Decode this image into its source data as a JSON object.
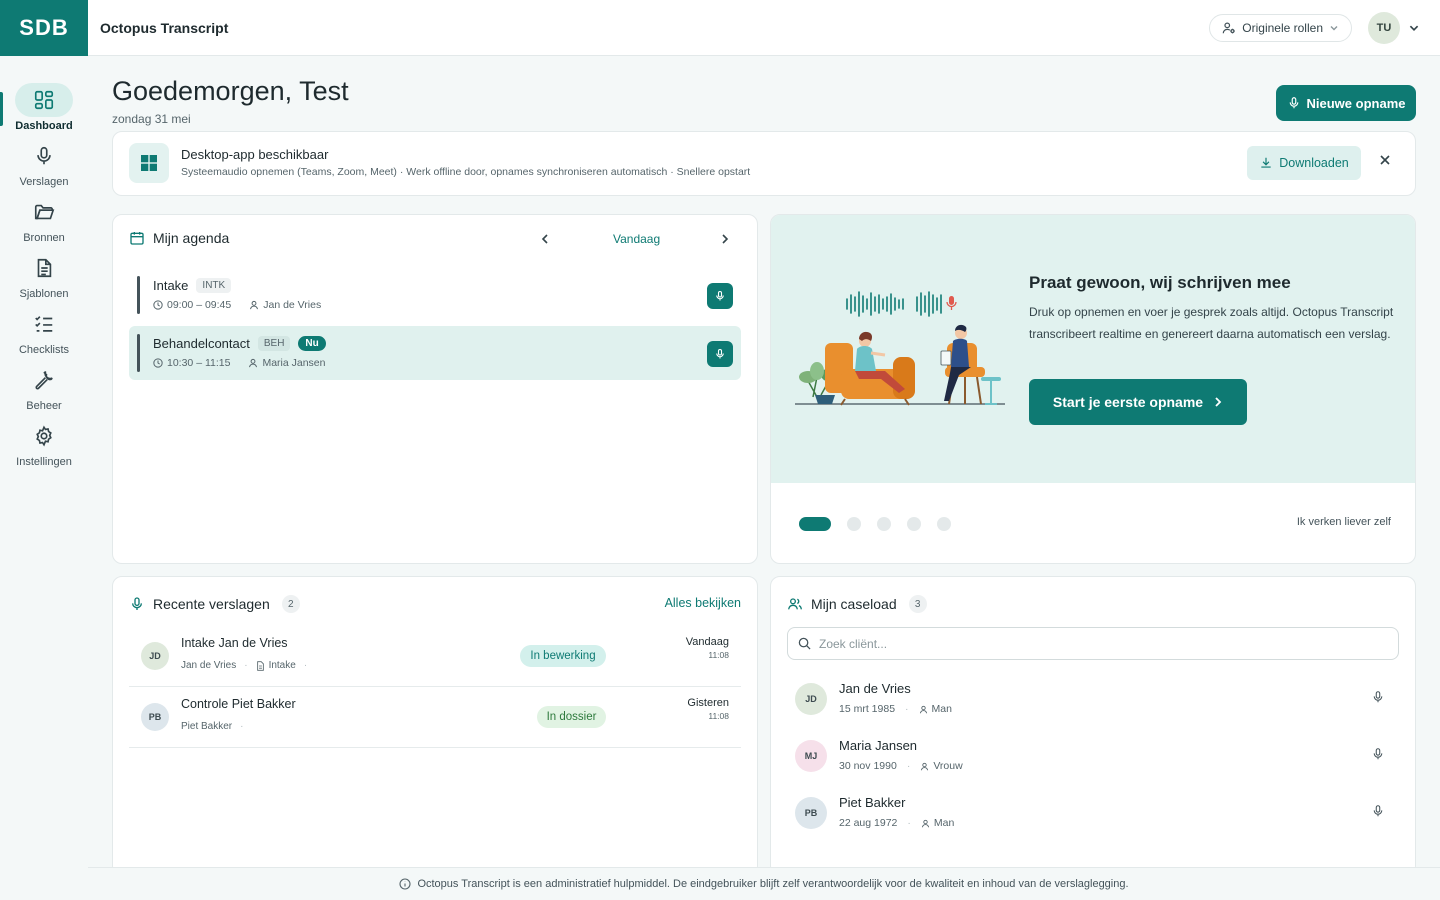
{
  "header": {
    "logo_text": "SDB",
    "app_title": "Octopus Transcript",
    "role_label": "Originele rollen",
    "user_initials": "TU"
  },
  "sidebar": {
    "items": [
      {
        "label": "Dashboard",
        "icon": "dashboard-icon",
        "active": true
      },
      {
        "label": "Verslagen",
        "icon": "mic-icon"
      },
      {
        "label": "Bronnen",
        "icon": "folder-icon"
      },
      {
        "label": "Sjablonen",
        "icon": "document-icon"
      },
      {
        "label": "Checklists",
        "icon": "checklist-icon"
      },
      {
        "label": "Beheer",
        "icon": "wrench-icon"
      },
      {
        "label": "Instellingen",
        "icon": "gear-icon"
      }
    ]
  },
  "page": {
    "greeting": "Goedemorgen, Test",
    "date": "zondag 31 mei",
    "new_recording_label": "Nieuwe opname"
  },
  "banner": {
    "title": "Desktop-app beschikbaar",
    "subtitle": "Systeemaudio opnemen (Teams, Zoom, Meet) · Werk offline door, opnames synchroniseren automatisch · Snellere opstart",
    "download_label": "Downloaden"
  },
  "agenda": {
    "title": "Mijn agenda",
    "today_label": "Vandaag",
    "events": [
      {
        "title": "Intake",
        "tag": "INTK",
        "time": "09:00 – 09:45",
        "client": "Jan de Vries",
        "now": false
      },
      {
        "title": "Behandelcontact",
        "tag": "BEH",
        "now_label": "Nu",
        "time": "10:30 – 11:15",
        "client": "Maria Jansen",
        "now": true
      }
    ]
  },
  "promo": {
    "title": "Praat gewoon, wij schrijven mee",
    "text": "Druk op opnemen en voer je gesprek zoals altijd. Octopus Transcript transcribeert realtime en genereert daarna automatisch een verslag.",
    "button_label": "Start je eerste opname",
    "skip_label": "Ik verken liever zelf",
    "slide_count": 5,
    "active_slide": 1
  },
  "reports": {
    "title": "Recente verslagen",
    "count": "2",
    "see_all_label": "Alles bekijken",
    "items": [
      {
        "initials": "JD",
        "title": "Intake Jan de Vries",
        "client": "Jan de Vries",
        "template": "Intake",
        "status": "In bewerking",
        "when": "Vandaag",
        "time": "11:08"
      },
      {
        "initials": "PB",
        "title": "Controle Piet Bakker",
        "client": "Piet Bakker",
        "template": "",
        "status": "In dossier",
        "when": "Gisteren",
        "time": "11:08"
      }
    ]
  },
  "caseload": {
    "title": "Mijn caseload",
    "count": "3",
    "search_placeholder": "Zoek cliënt...",
    "clients": [
      {
        "initials": "JD",
        "name": "Jan de Vries",
        "dob": "15 mrt 1985",
        "gender": "Man"
      },
      {
        "initials": "MJ",
        "name": "Maria Jansen",
        "dob": "30 nov 1990",
        "gender": "Vrouw"
      },
      {
        "initials": "PB",
        "name": "Piet Bakker",
        "dob": "22 aug 1972",
        "gender": "Man"
      }
    ]
  },
  "footer": {
    "disclaimer": "Octopus Transcript is een administratief hulpmiddel. De eindgebruiker blijft zelf verantwoordelijk voor de kwaliteit en inhoud van de verslaglegging."
  },
  "colors": {
    "brand": "#0e7a73",
    "background": "#f4f8f8",
    "promo_bg": "#e1f2ef",
    "status_editing_bg": "#d3f0ec",
    "status_filed_bg": "#e1f3e3"
  }
}
